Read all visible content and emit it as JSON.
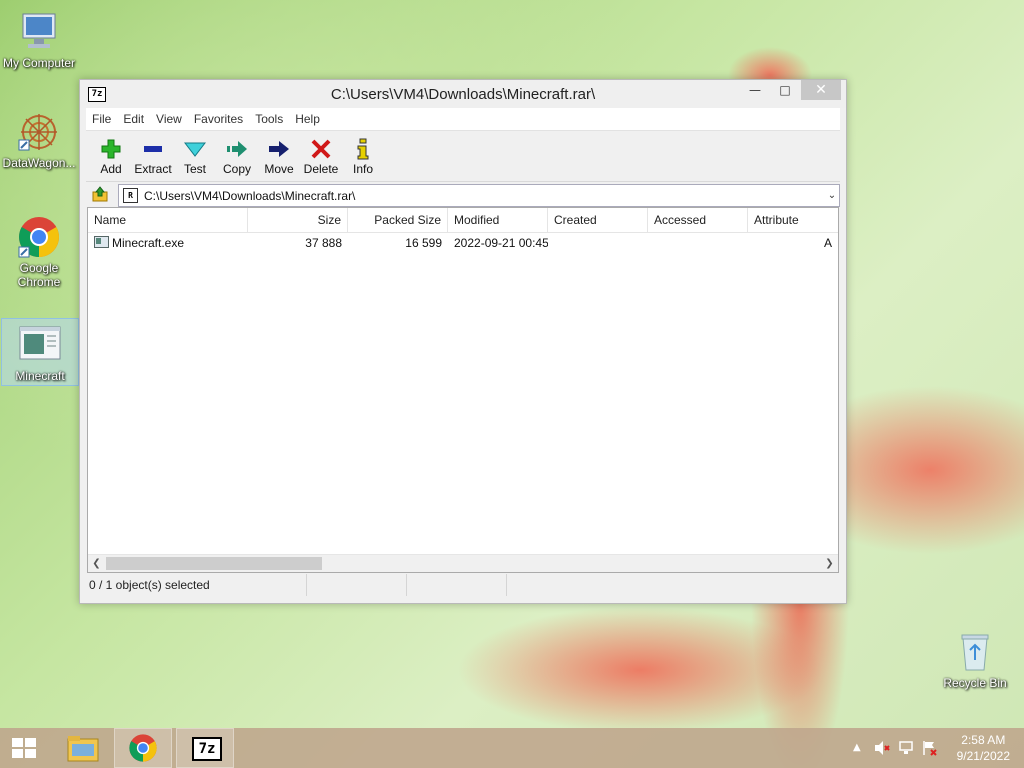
{
  "desktop": {
    "icons": [
      {
        "label": "My Computer"
      },
      {
        "label": "DataWagon..."
      },
      {
        "label": "Google Chrome"
      },
      {
        "label": "Minecraft"
      },
      {
        "label": "Recycle Bin"
      }
    ]
  },
  "window": {
    "title": "C:\\Users\\VM4\\Downloads\\Minecraft.rar\\",
    "app_icon": "7z",
    "menu": [
      "File",
      "Edit",
      "View",
      "Favorites",
      "Tools",
      "Help"
    ],
    "toolbar": [
      {
        "label": "Add",
        "icon": "plus-icon",
        "color": "#2bb52b"
      },
      {
        "label": "Extract",
        "icon": "minus-icon",
        "color": "#1c2ea8"
      },
      {
        "label": "Test",
        "icon": "check-icon",
        "color": "#2ab7c4"
      },
      {
        "label": "Copy",
        "icon": "copy-arrow-icon",
        "color": "#1f8f70"
      },
      {
        "label": "Move",
        "icon": "move-arrow-icon",
        "color": "#16206e"
      },
      {
        "label": "Delete",
        "icon": "delete-x-icon",
        "color": "#d01818"
      },
      {
        "label": "Info",
        "icon": "info-icon",
        "color": "#d8c000"
      }
    ],
    "address": "C:\\Users\\VM4\\Downloads\\Minecraft.rar\\",
    "columns": [
      "Name",
      "Size",
      "Packed Size",
      "Modified",
      "Created",
      "Accessed",
      "Attribute"
    ],
    "rows": [
      {
        "name": "Minecraft.exe",
        "size": "37 888",
        "packed": "16 599",
        "modified": "2022-09-21 00:45",
        "created": "",
        "accessed": "",
        "attr": "A"
      }
    ],
    "status": "0 / 1 object(s) selected"
  },
  "taskbar": {
    "time": "2:58 AM",
    "date": "9/21/2022",
    "seven_zip_label": "7z"
  }
}
